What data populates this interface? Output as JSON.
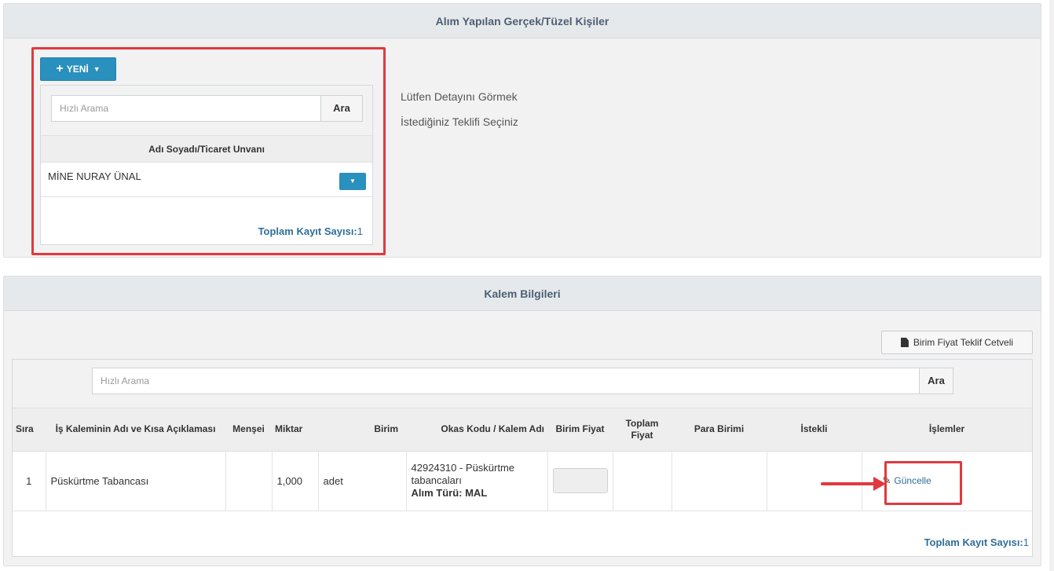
{
  "parties_panel": {
    "title": "Alım Yapılan Gerçek/Tüzel Kişiler",
    "new_button": "YENİ",
    "search": {
      "placeholder": "Hızlı Arama",
      "button": "Ara"
    },
    "column_header": "Adı Soyadı/Ticaret Unvanı",
    "rows": [
      {
        "name": "MİNE NURAY ÜNAL"
      }
    ],
    "total_label": "Toplam Kayıt Sayısı:",
    "total_value": "1",
    "hint_line1": "Lütfen Detayını Görmek",
    "hint_line2": "İstediğiniz Teklifi Seçiniz"
  },
  "items_panel": {
    "title": "Kalem Bilgileri",
    "cetvel_button": "Birim Fiyat Teklif Cetveli",
    "search": {
      "placeholder": "Hızlı Arama",
      "button": "Ara"
    },
    "columns": {
      "sira": "Sıra",
      "is_kalemi": "İş Kaleminin Adı ve Kısa Açıklaması",
      "mensei": "Menşei",
      "miktar": "Miktar",
      "birim": "Birim",
      "okas": "Okas Kodu / Kalem Adı",
      "birim_fiyat": "Birim Fiyat",
      "toplam_fiyat": "Toplam Fiyat",
      "para_birimi": "Para Birimi",
      "istekli": "İstekli",
      "islemler": "İşlemler"
    },
    "rows": [
      {
        "sira": "1",
        "is_kalemi": "Püskürtme Tabancası",
        "mensei": "",
        "miktar": "1,000",
        "birim": "adet",
        "okas_code": "42924310 - Püskürtme tabancaları",
        "alim_turu": "Alım Türü: MAL",
        "toplam_fiyat": "",
        "para_birimi": "",
        "istekli": "",
        "action": "Güncelle"
      }
    ],
    "total_label": "Toplam Kayıt Sayısı:",
    "total_value": "1"
  },
  "icons": {
    "plus": "plus-icon",
    "caret": "caret-down-icon",
    "document": "document-icon",
    "pencil": "pencil-icon"
  },
  "colors": {
    "primary_button": "#2a90bd",
    "highlight": "#e0393e",
    "link": "#2f6e9a",
    "panel_heading_text": "#4d5f74"
  }
}
